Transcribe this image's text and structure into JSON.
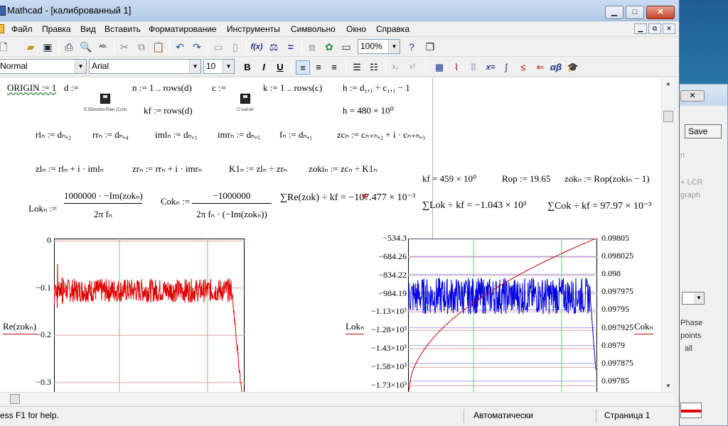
{
  "window": {
    "title": "Mathcad - [калиброванный 1]",
    "buttons": {
      "minimize": "▁",
      "maximize": "□",
      "close": "✕",
      "doc_minimize": "▁",
      "doc_restore": "⧉",
      "doc_close": "✕"
    }
  },
  "menu": [
    "Файл",
    "Правка",
    "Вид",
    "Вставить",
    "Форматирование",
    "Инструменты",
    "Символьно",
    "Окно",
    "Справка"
  ],
  "toolbar": {
    "zoom": "100%",
    "style": "Normal",
    "font": "Arial",
    "size": "10",
    "bold": "B",
    "italic": "I",
    "underline": "U",
    "fx": "f(x)",
    "x_eq": "x=",
    "alpha_beta": "αβ"
  },
  "worksheet": {
    "line1": {
      "origin": "ORIGIN := 1",
      "d_def": "d :=",
      "file1": "E:\\Ekmotor.Raw (1).txt",
      "n_def": "n := 1 .. rows(d)",
      "kf_rows": "kf := rows(d)",
      "c_def": "c :=",
      "file2": "C:\\cal.txt",
      "k_def": "k := 1 .. rows(c)",
      "h_def": "h := d₁,₁ ÷ c₁,₁ − 1",
      "h_val": "h = 480 × 10⁰"
    },
    "line2": {
      "rl": "rlₙ := dₙ,₂",
      "rr": "rrₙ := dₙ,₄",
      "iml": "imlₙ := dₙ,₃",
      "imr": "imrₙ := dₙ,₅",
      "f": "fₙ := dₙ,₁",
      "zc": "zcₙ := cₙ₊ₕ,₂ + i · cₙ₊ₕ,₃"
    },
    "line3": {
      "zl": "zlₙ := rlₙ + i · imlₙ",
      "zr": "zrₙ := rrₙ + i · imrₙ",
      "K1": "K1ₙ := zlₙ ÷ zrₙ",
      "zoki": "zokiₙ := zcₙ ÷ K1ₙ",
      "kf_val": "kf = 459 × 10⁰",
      "rop": "Rop := 19.65",
      "zok": "zokₙ := Rop(zokiₙ − 1)"
    },
    "line4": {
      "lok_lhs": "Lokₙ :=",
      "lok_num": "1000000 · −Im(zokₙ)",
      "lok_den": "2π fₙ",
      "cok_lhs": "Cokₙ :=",
      "cok_num": "−1000000",
      "cok_den": "2π fₙ · (−Im(zokₙ))",
      "sum1": "∑Re(zok) ÷ kf = −107.477 × 10⁻³",
      "sum2": "∑Lok ÷ kf = −1.043 × 10³",
      "sum3": "∑Cok ÷ kf = 97.97 × 10⁻³"
    }
  },
  "chart_data": [
    {
      "type": "line",
      "ylabel": "Re(zokₙ)",
      "ytick_labels": [
        "0",
        "−0.1",
        "−0.2",
        "−0.3"
      ],
      "ylim": [
        -0.32,
        0.005
      ],
      "series": [
        {
          "color": "#e00000",
          "level": -0.105,
          "noise": 0.025,
          "drop_at_end": true
        }
      ]
    },
    {
      "type": "line",
      "ylabel_left": "Lokₙ",
      "ylabel_right": "Cokₙ",
      "ytick_labels_left": [
        "−534.3",
        "−684.26",
        "−834.22",
        "−984.19",
        "−1.13×10³",
        "−1.28×10³",
        "−1.43×10³",
        "−1.58×10³",
        "−1.73×10³"
      ],
      "ytick_labels_right": [
        "0.09805",
        "0.098025",
        "0.098",
        "0.097975",
        "0.09795",
        "0.097925",
        "0.0979",
        "0.097875",
        "0.09785"
      ],
      "ylim_left": [
        -1780,
        -534.3
      ],
      "ylim_right": [
        0.097835,
        0.09805
      ],
      "series": [
        {
          "color": "#0000e0",
          "axis": "left",
          "level": -1000,
          "noise": 150
        },
        {
          "color": "#c00000",
          "axis": "right",
          "shape": "rising-curve",
          "start": 0.09783,
          "end": 0.09805
        }
      ]
    }
  ],
  "status": {
    "help": "ess F1 for help.",
    "mode": "Автоматически",
    "page": "Страница 1"
  },
  "bg_window": {
    "close": "✕",
    "save": "Save",
    "text_lcr": "+ LCR",
    "text_graph": "graph",
    "text_n": "n",
    "text_phase": "Phase",
    "text_points": "points",
    "text_all": "all"
  }
}
